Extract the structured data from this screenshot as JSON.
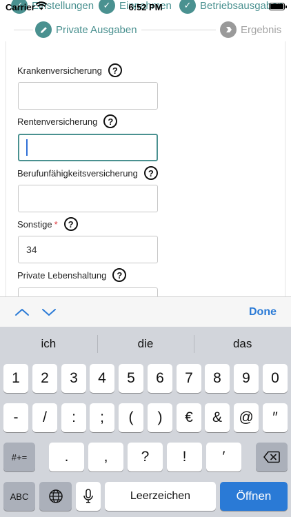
{
  "status_bar": {
    "carrier": "Carrier",
    "time": "6:52 PM"
  },
  "stepper": {
    "steps": [
      {
        "label": "Einstellungen",
        "state": "done"
      },
      {
        "label": "Einnahmen",
        "state": "done"
      },
      {
        "label": "Betriebsausgaben",
        "state": "done"
      },
      {
        "label": "Private Ausgaben",
        "state": "active"
      },
      {
        "label": "Ergebnis",
        "state": "pending"
      }
    ]
  },
  "form": {
    "fields": [
      {
        "label": "Krankenversicherung",
        "value": "",
        "required": false,
        "help": "?"
      },
      {
        "label": "Rentenversicherung",
        "value": "",
        "required": false,
        "help": "?",
        "focused": true
      },
      {
        "label": "Berufunfähigkeitsversicherung",
        "value": "",
        "required": false,
        "help": "?"
      },
      {
        "label": "Sonstige",
        "value": "34",
        "required": true,
        "required_mark": "*",
        "help": "?"
      },
      {
        "label": "Private Lebenshaltung",
        "value": "",
        "required": false,
        "help": "?"
      }
    ]
  },
  "accessory": {
    "done_label": "Done",
    "prev_icon": "chevron-up-icon",
    "next_icon": "chevron-down-icon"
  },
  "keyboard": {
    "suggestions": [
      "ich",
      "die",
      "das"
    ],
    "row1": [
      "1",
      "2",
      "3",
      "4",
      "5",
      "6",
      "7",
      "8",
      "9",
      "0"
    ],
    "row2": [
      "-",
      "/",
      ":",
      ";",
      "(",
      ")",
      "€",
      "&",
      "@",
      "″"
    ],
    "row3": [
      ".",
      ",",
      "?",
      "!",
      "′"
    ],
    "shift_label": "#+=",
    "abc_label": "ABC",
    "space_label": "Leerzeichen",
    "go_label": "Öffnen",
    "accent_color": "#4a9190",
    "go_color": "#2a7ad6"
  }
}
